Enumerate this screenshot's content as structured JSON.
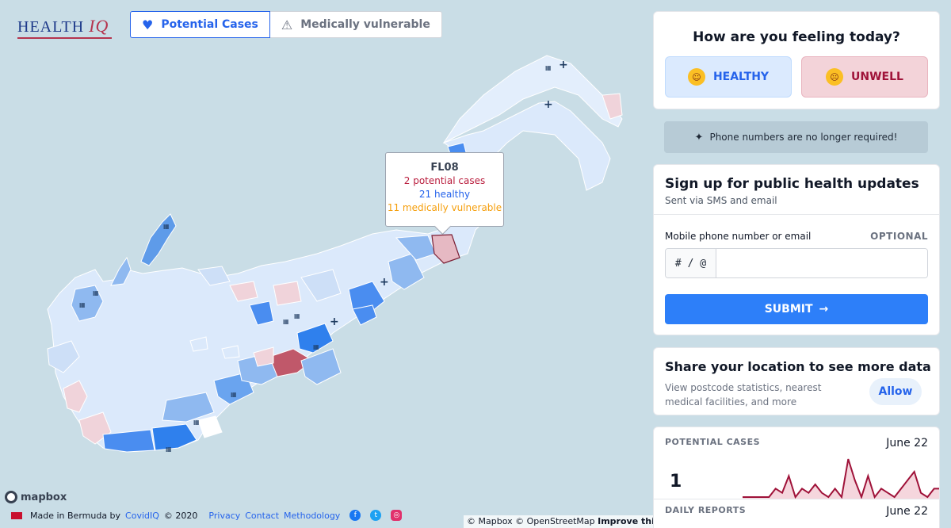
{
  "logo": {
    "health": "HEALTH",
    "iq": "IQ"
  },
  "tabs": [
    {
      "label": "Potential Cases",
      "icon": "heartbeat-icon",
      "active": true
    },
    {
      "label": "Medically vulnerable",
      "icon": "warning-icon",
      "active": false
    }
  ],
  "tooltip": {
    "title": "FL08",
    "potential": "2 potential cases",
    "healthy": "21 healthy",
    "vulnerable": "11 medically vulnerable"
  },
  "mapbox_logo": "mapbox",
  "footer": {
    "made_in": "Made in Bermuda by",
    "company": "CovidIQ",
    "year": "© 2020",
    "links": [
      "Privacy",
      "Contact",
      "Methodology"
    ]
  },
  "attribution": {
    "mapbox": "© Mapbox",
    "osm": "© OpenStreetMap",
    "improve": "Improve this map"
  },
  "feeling": {
    "title": "How are you feeling today?",
    "healthy_label": "HEALTHY",
    "unwell_label": "UNWELL"
  },
  "notice": {
    "icon": "party-popper-icon",
    "text": "Phone numbers are no longer required!"
  },
  "signup": {
    "title": "Sign up for public health updates",
    "subtitle": "Sent via SMS and email",
    "field_label": "Mobile phone number or email",
    "optional": "OPTIONAL",
    "prefix": "# / @",
    "placeholder": "",
    "submit": "SUBMIT"
  },
  "share": {
    "title": "Share your location to see more data",
    "text": "View postcode statistics, nearest medical facilities, and more",
    "button": "Allow"
  },
  "stats": {
    "potential_label": "POTENTIAL CASES",
    "potential_date": "June 22",
    "potential_value": "1",
    "daily_label": "DAILY REPORTS",
    "daily_date": "June 22"
  },
  "chart_data": {
    "type": "area",
    "values": [
      0,
      0,
      0,
      0,
      0,
      2,
      1,
      5,
      0,
      2,
      1,
      3,
      1,
      0,
      2,
      0,
      9,
      4,
      0,
      5,
      0,
      2,
      1,
      0,
      2,
      4,
      6,
      1,
      0,
      2,
      2
    ]
  },
  "colors": {
    "accent": "#2d7ff9",
    "unwell": "#9f1239",
    "map_water": "#c9dde6",
    "map_light": "#dbe9fb",
    "map_mid": "#8fb9f0",
    "map_dark": "#2f80ed",
    "map_pink": "#f0d3da",
    "map_red": "#c0586a"
  }
}
